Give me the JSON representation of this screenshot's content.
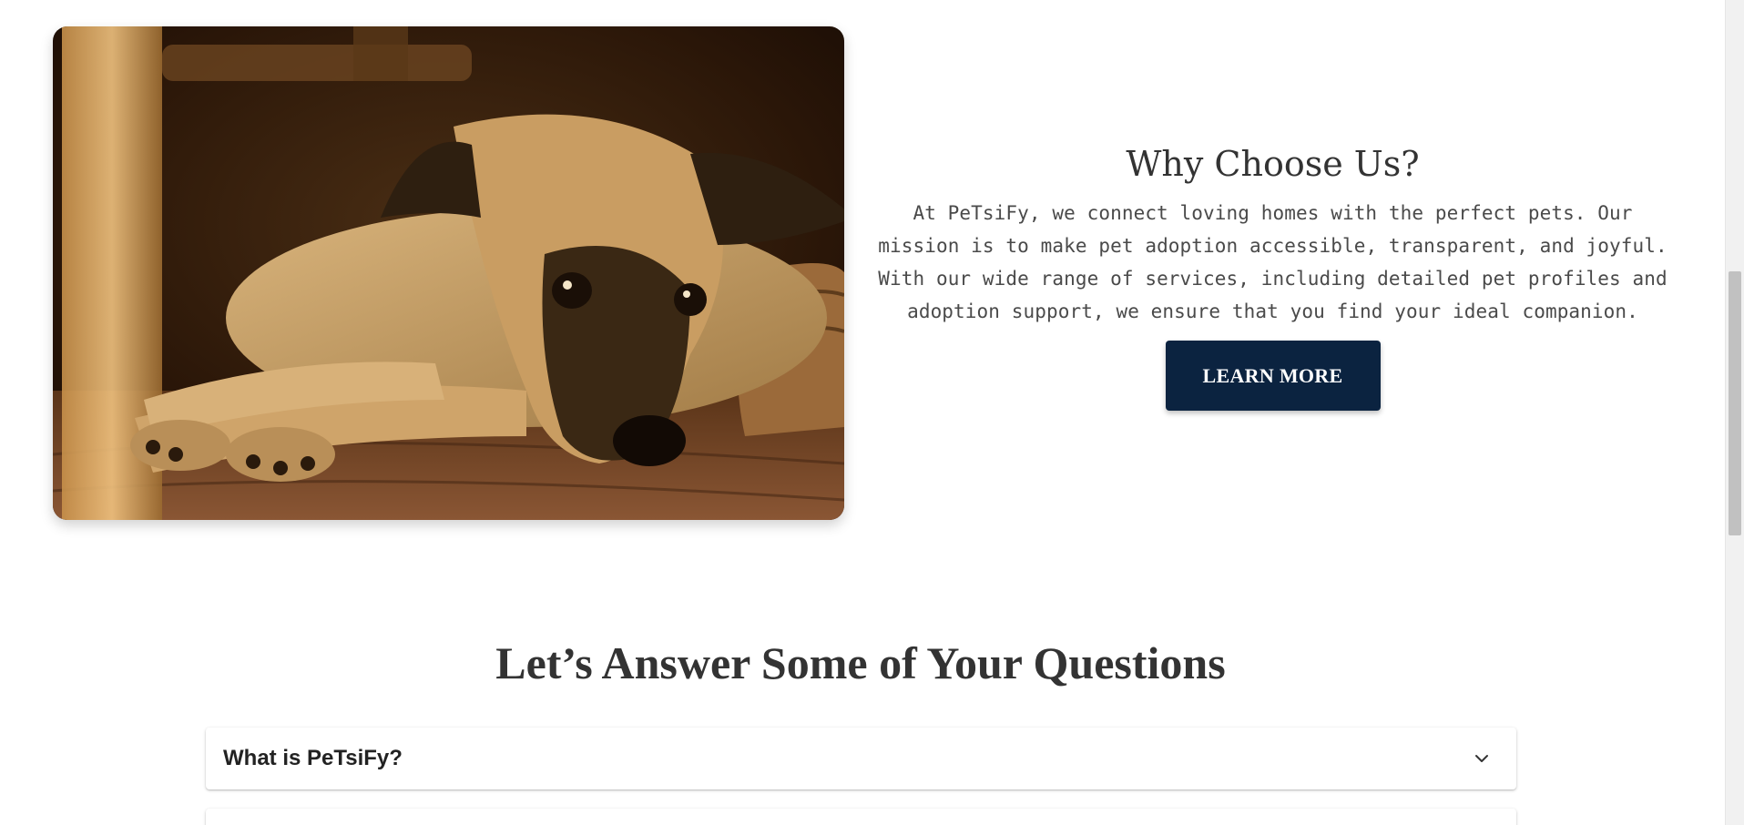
{
  "hero": {
    "image_subject": "dog lying on wooden floor"
  },
  "why_section": {
    "title": "Why Choose Us?",
    "body": "At PeTsiFy, we connect loving homes with the perfect pets. Our mission is to make pet adoption accessible, transparent, and joyful. With our wide range of services, including detailed pet profiles and adoption support, we ensure that you find your ideal companion.",
    "button_label": "LEARN MORE"
  },
  "faq": {
    "title": "Let’s Answer Some of Your Questions",
    "items": [
      {
        "question": "What is PeTsiFy?",
        "icon": "chevron-down-icon"
      },
      {
        "question": "",
        "icon": "chevron-down-icon"
      }
    ]
  },
  "colors": {
    "button_bg": "#0b2340",
    "button_text": "#ffffff",
    "heading": "#333333",
    "body_text": "#4a4a4a"
  }
}
